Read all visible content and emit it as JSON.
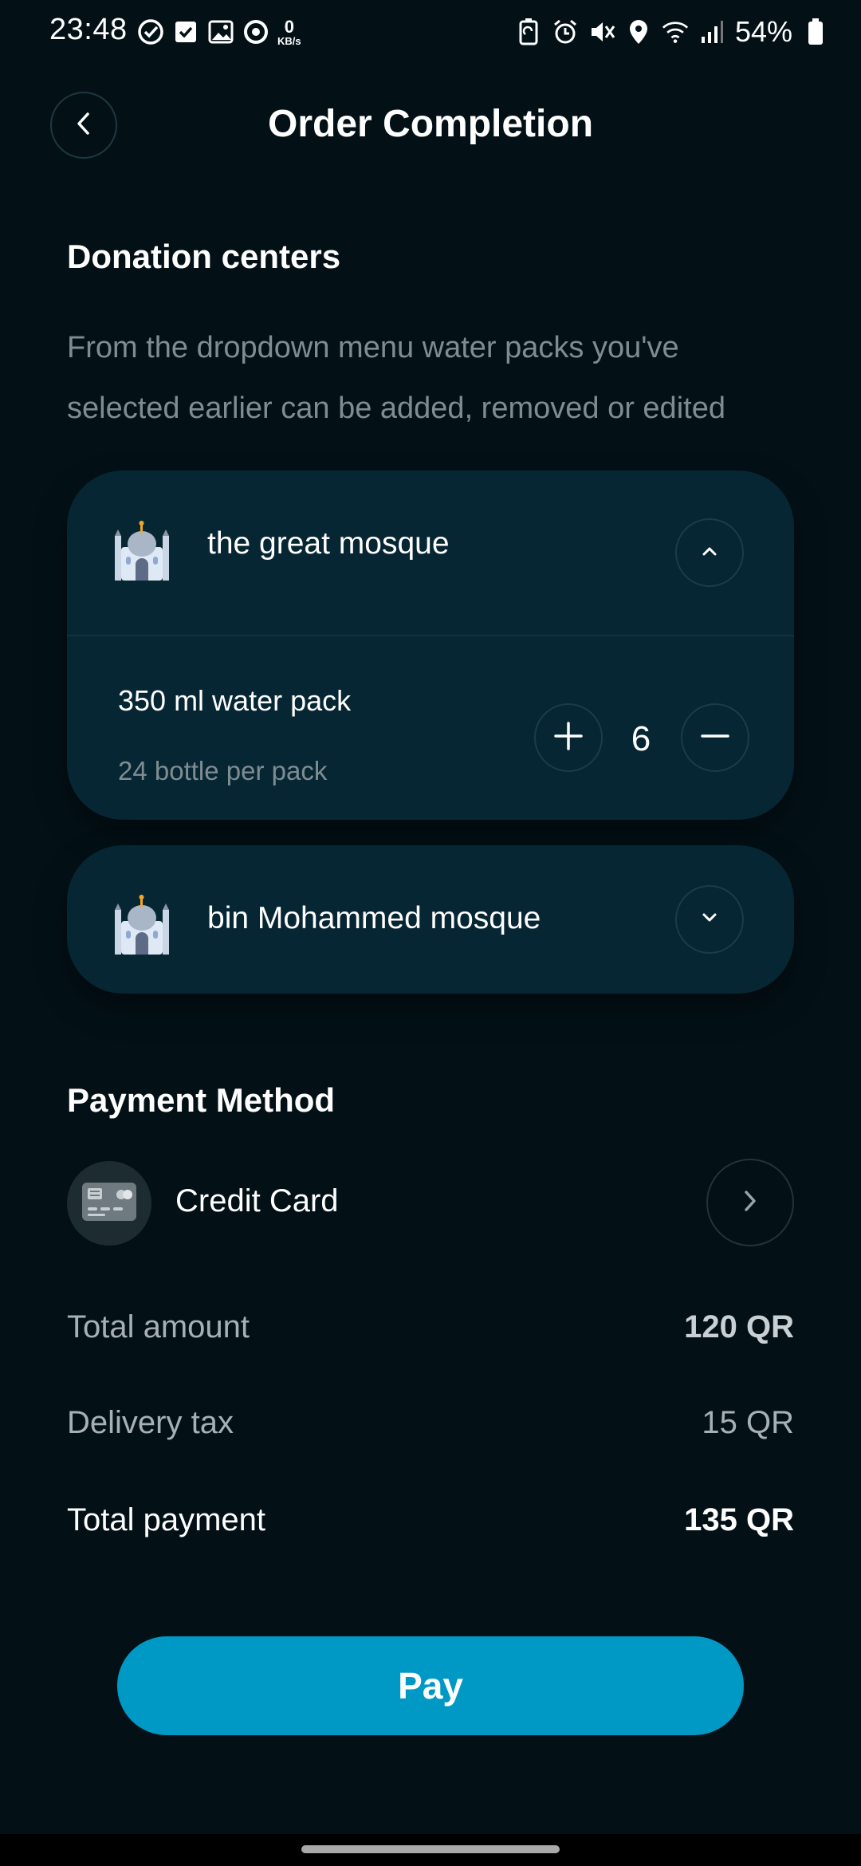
{
  "status_bar": {
    "time": "23:48",
    "net_speed_value": "0",
    "net_speed_unit": "KB/s",
    "battery": "54%",
    "icons_left": [
      "check-circle-icon",
      "check-box-icon",
      "image-icon",
      "sync-icon"
    ],
    "icons_right": [
      "battery-saver-icon",
      "alarm-icon",
      "mute-icon",
      "location-icon",
      "wifi-icon",
      "signal-icon",
      "battery-icon"
    ]
  },
  "header": {
    "title": "Order Completion"
  },
  "donation": {
    "title": "Donation centers",
    "description": "From the dropdown menu water packs you've selected earlier can be added, removed or edited",
    "centers": [
      {
        "name": "the great mosque",
        "expanded": true,
        "items": [
          {
            "title": "350 ml water pack",
            "subtitle": "24 bottle per pack",
            "quantity": "6"
          }
        ]
      },
      {
        "name": "bin Mohammed mosque",
        "expanded": false
      }
    ]
  },
  "payment": {
    "title": "Payment Method",
    "method": "Credit Card"
  },
  "summary": {
    "total_amount_label": "Total amount",
    "total_amount_value": "120 QR",
    "delivery_tax_label": "Delivery tax",
    "delivery_tax_value": "15 QR",
    "total_payment_label": "Total payment",
    "total_payment_value": "135 QR"
  },
  "actions": {
    "pay_label": "Pay"
  },
  "colors": {
    "background": "#031117",
    "card": "#072633",
    "accent": "#0099c6",
    "muted_text": "#7e8d92"
  }
}
